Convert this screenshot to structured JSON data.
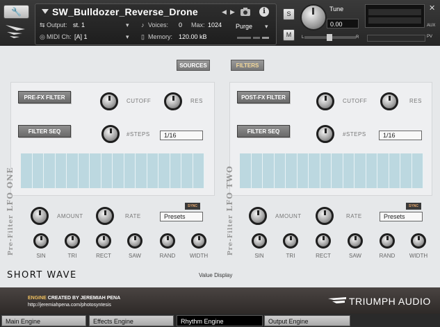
{
  "header": {
    "instrument_name": "SW_Bulldozer_Reverse_Drone",
    "output_label": "Output:",
    "output_value": "st. 1",
    "midi_label": "MIDI Ch:",
    "midi_value": "[A]  1",
    "voices_label": "Voices:",
    "voices_value": "0",
    "max_label": "Max:",
    "max_value": "1024",
    "memory_label": "Memory:",
    "memory_value": "120.00 kB",
    "purge_label": "Purge",
    "solo_label": "S",
    "mute_label": "M",
    "tune_label": "Tune",
    "tune_value": "0.00",
    "pan_left": "L",
    "pan_right": "R",
    "aux_label": "AUX",
    "pv_label": "PV"
  },
  "tabs": {
    "sources": "SOURCES",
    "filters": "FILTERS"
  },
  "filter_left": {
    "filter_button": "PRE-FX FILTER",
    "cutoff_label": "CUTOFF",
    "res_label": "RES",
    "seq_button": "FILTER SEQ",
    "steps_label": "#STEPS",
    "steps_value": "1/16"
  },
  "filter_right": {
    "filter_button": "POST-FX FILTER",
    "cutoff_label": "CUTOFF",
    "res_label": "RES",
    "seq_button": "FILTER SEQ",
    "steps_label": "#STEPS",
    "steps_value": "1/16"
  },
  "lfo_one": {
    "title": "LFO ONE",
    "subtitle": "Pre-Filter",
    "amount_label": "AMOUNT",
    "rate_label": "RATE",
    "sync_label": "SYNC",
    "presets_value": "Presets",
    "shapes": [
      "SIN",
      "TRI",
      "RECT",
      "SAW",
      "RAND",
      "WIDTH"
    ]
  },
  "lfo_two": {
    "title": "LFO TWO",
    "subtitle": "Pre-Filter",
    "amount_label": "AMOUNT",
    "rate_label": "RATE",
    "sync_label": "SYNC",
    "presets_value": "Presets",
    "shapes": [
      "SIN",
      "TRI",
      "RECT",
      "SAW",
      "RAND",
      "WIDTH"
    ]
  },
  "display": {
    "brand": "SHORT WAVE",
    "value_display": "Value Display"
  },
  "footer": {
    "credit_engine": "ENGINE",
    "credit_rest": " CREATED BY JEREMIAH PENA",
    "credit_url": "http://jeremiahpena.com/photosyntesis",
    "brand": "TRIUMPH AUDIO"
  },
  "bottom_tabs": {
    "main": "Main Engine",
    "effects": "Effects Engine",
    "rhythm": "Rhythm Engine",
    "output": "Output Engine"
  }
}
